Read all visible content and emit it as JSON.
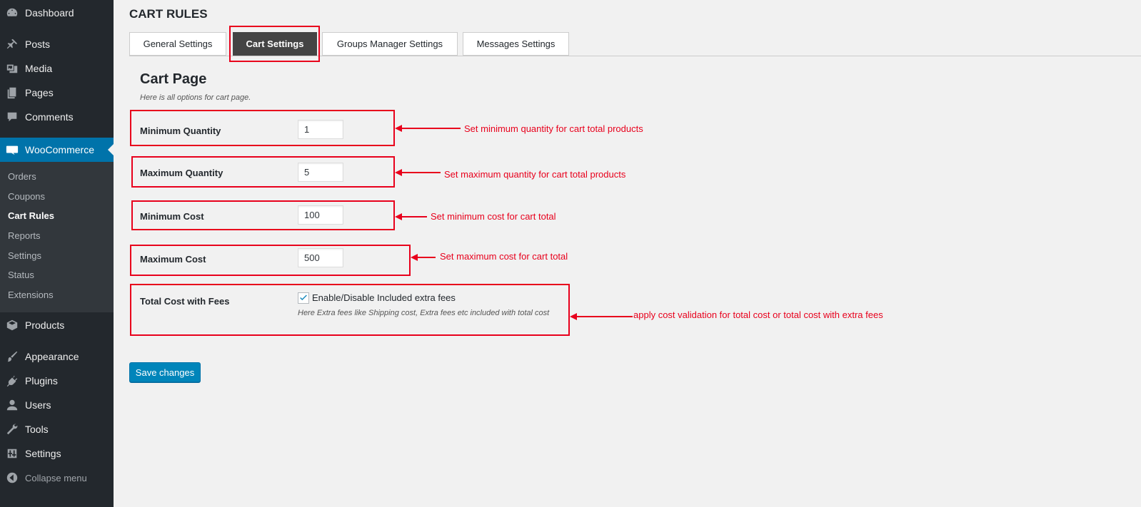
{
  "sidebar": {
    "top_items": [
      {
        "label": "Dashboard",
        "icon": "dashboard-icon"
      },
      {
        "label": "Posts",
        "icon": "pin-icon"
      },
      {
        "label": "Media",
        "icon": "media-icon"
      },
      {
        "label": "Pages",
        "icon": "pages-icon"
      },
      {
        "label": "Comments",
        "icon": "comment-icon"
      },
      {
        "label": "WooCommerce",
        "icon": "woo-icon"
      }
    ],
    "submenu": [
      {
        "label": "Orders"
      },
      {
        "label": "Coupons"
      },
      {
        "label": "Cart Rules"
      },
      {
        "label": "Reports"
      },
      {
        "label": "Settings"
      },
      {
        "label": "Status"
      },
      {
        "label": "Extensions"
      }
    ],
    "bottom_items": [
      {
        "label": "Products",
        "icon": "products-icon"
      },
      {
        "label": "Appearance",
        "icon": "brush-icon"
      },
      {
        "label": "Plugins",
        "icon": "plugin-icon"
      },
      {
        "label": "Users",
        "icon": "user-icon"
      },
      {
        "label": "Tools",
        "icon": "wrench-icon"
      },
      {
        "label": "Settings",
        "icon": "settings-icon"
      }
    ],
    "collapse_label": "Collapse menu"
  },
  "page": {
    "title": "CART RULES",
    "tabs": [
      {
        "label": "General Settings"
      },
      {
        "label": "Cart Settings"
      },
      {
        "label": "Groups Manager Settings"
      },
      {
        "label": "Messages Settings"
      }
    ],
    "section_title": "Cart Page",
    "section_desc": "Here is all options for cart page.",
    "fields": [
      {
        "label": "Minimum Quantity",
        "value": "1"
      },
      {
        "label": "Maximum Quantity",
        "value": "5"
      },
      {
        "label": "Minimum Cost",
        "value": "100"
      },
      {
        "label": "Maximum Cost",
        "value": "500"
      }
    ],
    "fees": {
      "label": "Total Cost with Fees",
      "checkbox_label": "Enable/Disable Included extra fees",
      "checked": true,
      "description": "Here Extra fees like Shipping cost, Extra fees etc included with total cost"
    },
    "save_label": "Save changes"
  },
  "annotations": [
    "Set minimum quantity for cart total products",
    "Set maximum quantity for cart total products",
    "Set minimum cost for cart total",
    "Set maximum cost for cart total",
    "apply cost validation for total cost or total cost with extra fees"
  ],
  "colors": {
    "sidebar_bg": "#23282d",
    "submenu_bg": "#32373c",
    "active_blue": "#0073aa",
    "annotation_red": "#e8001c",
    "button_blue": "#0085ba"
  }
}
